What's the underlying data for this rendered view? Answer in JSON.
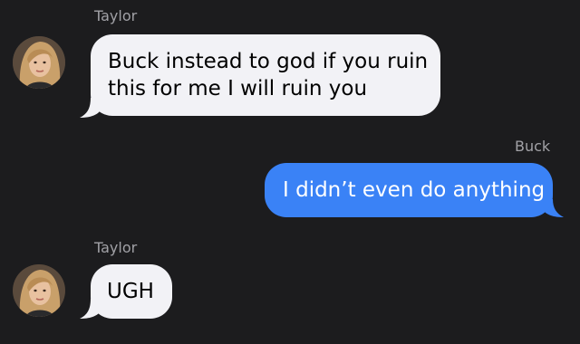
{
  "colors": {
    "background": "#1c1c1e",
    "incoming_bubble": "#f2f2f6",
    "outgoing_bubble": "#3a82f6",
    "sender_label": "#a1a1a6"
  },
  "messages": [
    {
      "direction": "incoming",
      "sender": "Taylor",
      "avatar": "contact-photo",
      "lines": [
        "Buck instead to god if you ruin",
        "this for me I will ruin you"
      ]
    },
    {
      "direction": "outgoing",
      "sender": "Buck",
      "lines": [
        "I didn’t even do anything"
      ]
    },
    {
      "direction": "incoming",
      "sender": "Taylor",
      "avatar": "contact-photo",
      "lines": [
        "UGH"
      ]
    }
  ]
}
